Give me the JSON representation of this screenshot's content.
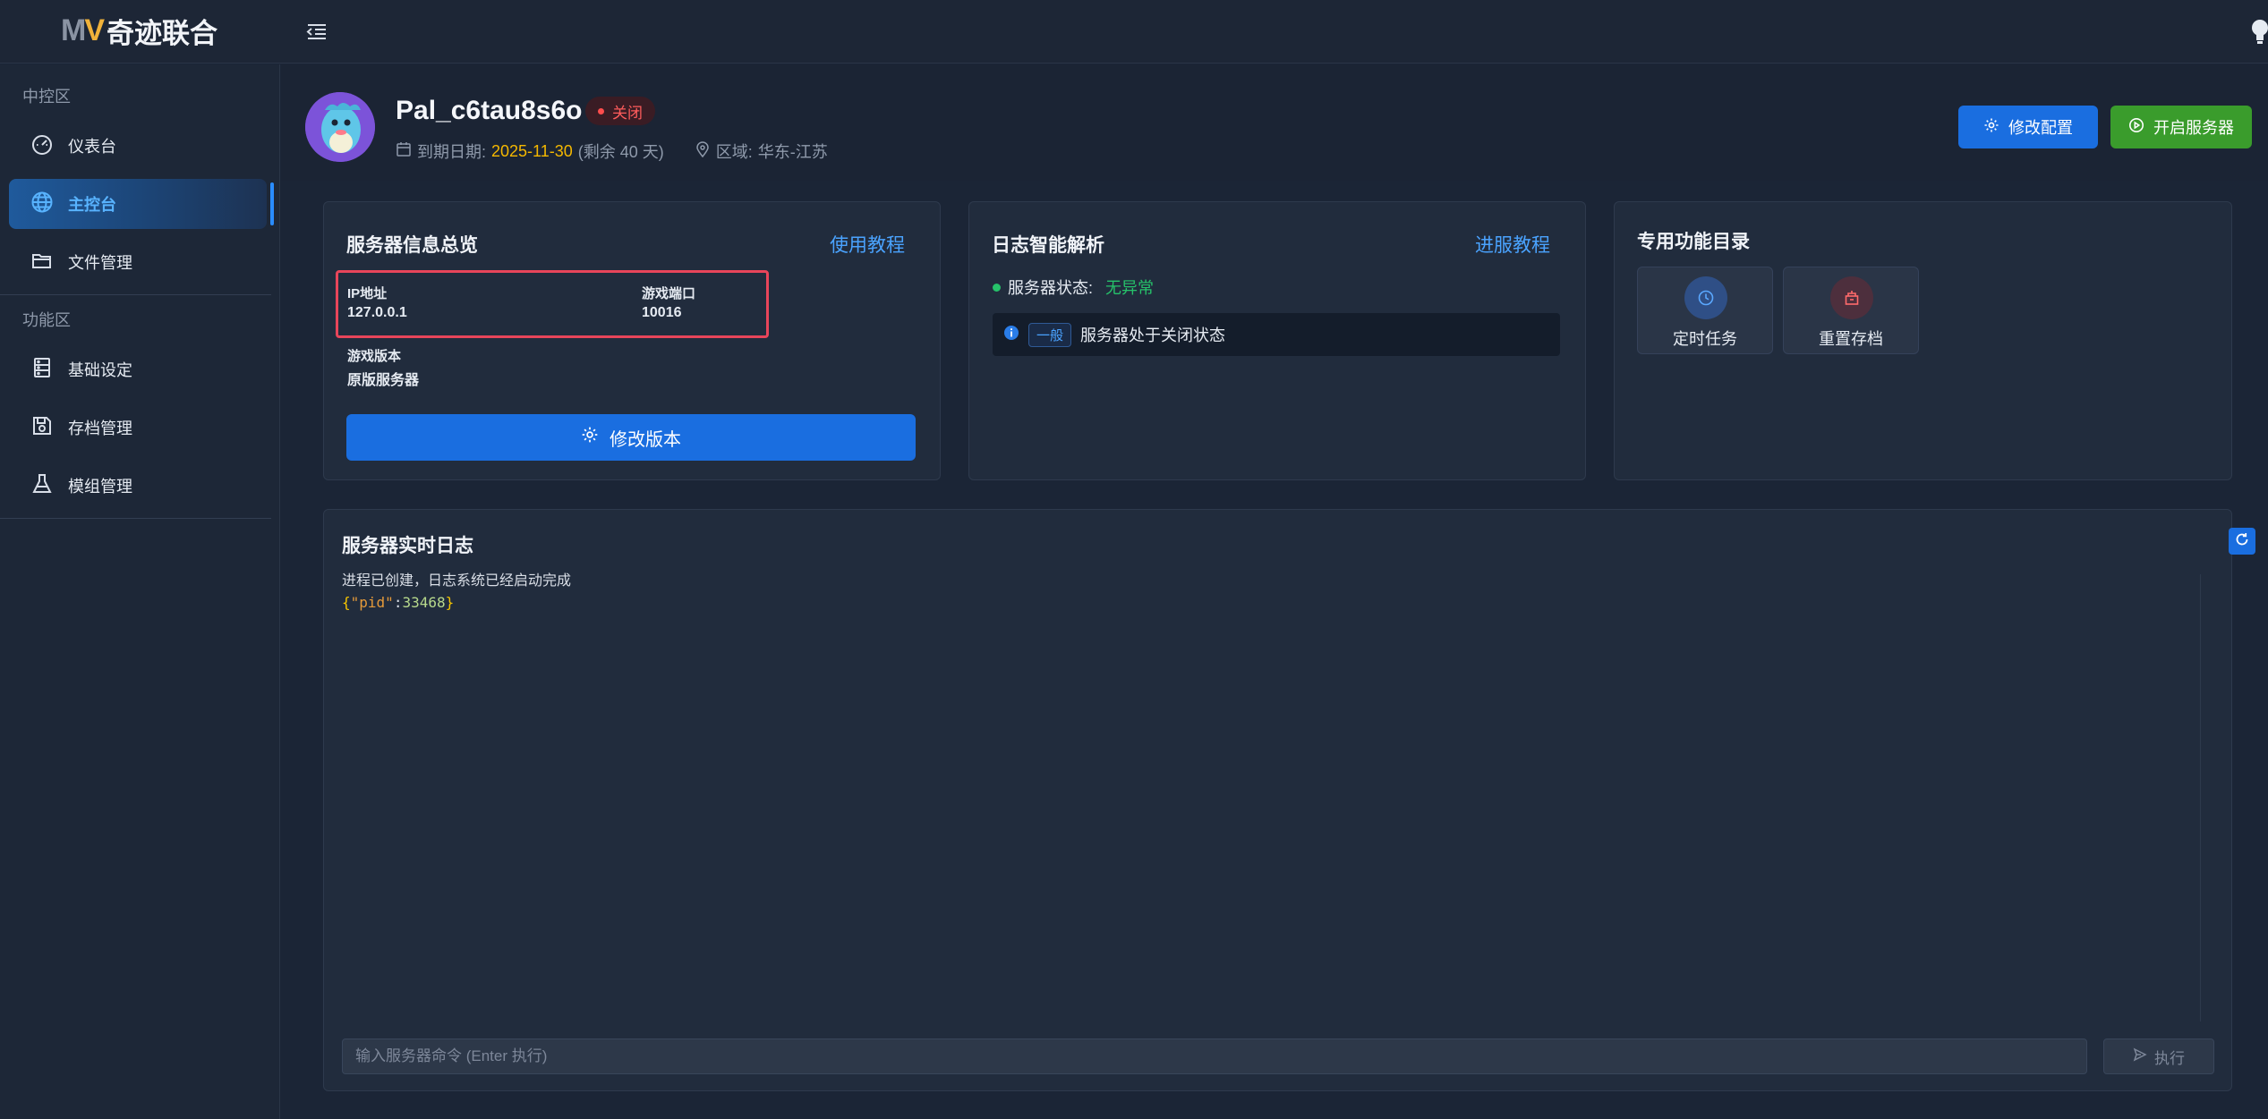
{
  "app": {
    "logo_mark_m": "M",
    "logo_mark_v": "V",
    "logo_text": "奇迹联合"
  },
  "sidebar": {
    "sections": [
      {
        "title": "中控区"
      },
      {
        "title": "功能区"
      }
    ],
    "items": [
      {
        "label": "仪表台",
        "icon": "dashboard-icon"
      },
      {
        "label": "主控台",
        "icon": "globe-icon",
        "active": true
      },
      {
        "label": "文件管理",
        "icon": "folder-icon"
      },
      {
        "label": "基础设定",
        "icon": "server-icon"
      },
      {
        "label": "存档管理",
        "icon": "save-icon"
      },
      {
        "label": "模组管理",
        "icon": "flask-icon"
      }
    ]
  },
  "header": {
    "server_name": "Pal_c6tau8s6o",
    "status": "关闭",
    "expiry_label": "到期日期:",
    "expiry_date": "2025-11-30",
    "remaining": "(剩余 40 天)",
    "region_label": "区域:",
    "region": "华东-江苏",
    "config_button": "修改配置",
    "start_button": "开启服务器"
  },
  "server_info": {
    "title": "服务器信息总览",
    "tutorial_link": "使用教程",
    "ip_label": "IP地址",
    "ip_value": "127.0.0.1",
    "port_label": "游戏端口",
    "port_value": "10016",
    "version_label": "游戏版本",
    "version_value": "原版服务器",
    "modify_version_button": "修改版本"
  },
  "log_analysis": {
    "title": "日志智能解析",
    "guide_link": "进服教程",
    "status_label": "服务器状态:",
    "status_value": "无异常",
    "info_tag": "一般",
    "info_text": "服务器处于关闭状态"
  },
  "features": {
    "title": "专用功能目录",
    "items": [
      {
        "label": "定时任务",
        "icon": "clock-icon"
      },
      {
        "label": "重置存档",
        "icon": "reset-archive-icon"
      }
    ]
  },
  "realtime_log": {
    "title": "服务器实时日志",
    "line1": "进程已创建，日志系统已经启动完成",
    "json_open": "{",
    "json_key": "\"pid\"",
    "json_colon": ":",
    "json_value": "33468",
    "json_close": "}",
    "command_placeholder": "输入服务器命令 (Enter 执行)",
    "execute_button": "执行"
  },
  "colors": {
    "accent_blue": "#1a6ee0",
    "start_green": "#3a9c2c",
    "status_red": "#ff5c5c",
    "ok_green": "#26c26a",
    "date_yellow": "#f5b800"
  }
}
